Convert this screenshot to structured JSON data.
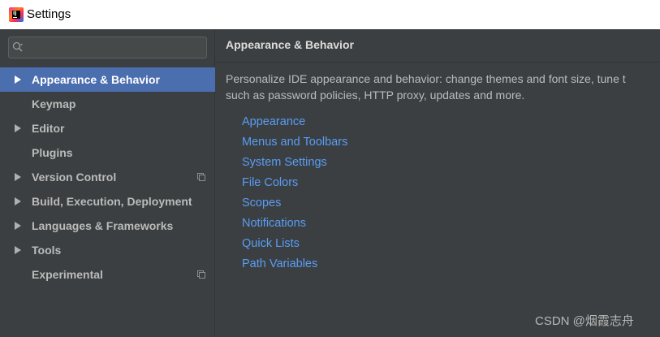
{
  "window": {
    "title": "Settings",
    "app_icon": "intellij-idea-icon"
  },
  "sidebar": {
    "search": {
      "value": "",
      "placeholder": "",
      "icon": "search-icon"
    },
    "items": [
      {
        "label": "Appearance & Behavior",
        "expandable": true,
        "selected": true,
        "copy_icon": false
      },
      {
        "label": "Keymap",
        "expandable": false,
        "selected": false,
        "copy_icon": false
      },
      {
        "label": "Editor",
        "expandable": true,
        "selected": false,
        "copy_icon": false
      },
      {
        "label": "Plugins",
        "expandable": false,
        "selected": false,
        "copy_icon": false
      },
      {
        "label": "Version Control",
        "expandable": true,
        "selected": false,
        "copy_icon": true
      },
      {
        "label": "Build, Execution, Deployment",
        "expandable": true,
        "selected": false,
        "copy_icon": false
      },
      {
        "label": "Languages & Frameworks",
        "expandable": true,
        "selected": false,
        "copy_icon": false
      },
      {
        "label": "Tools",
        "expandable": true,
        "selected": false,
        "copy_icon": false
      },
      {
        "label": "Experimental",
        "expandable": false,
        "selected": false,
        "copy_icon": true
      }
    ]
  },
  "main": {
    "title": "Appearance & Behavior",
    "description_line1": "Personalize IDE appearance and behavior: change themes and font size, tune t",
    "description_line2": "such as password policies, HTTP proxy, updates and more.",
    "links": [
      "Appearance",
      "Menus and Toolbars",
      "System Settings",
      "File Colors",
      "Scopes",
      "Notifications",
      "Quick Lists",
      "Path Variables"
    ]
  },
  "watermark": "CSDN @烟霞志舟",
  "colors": {
    "background": "#3c3f41",
    "selection": "#4b6eaf",
    "link": "#589df6",
    "text": "#bbbbbb"
  }
}
